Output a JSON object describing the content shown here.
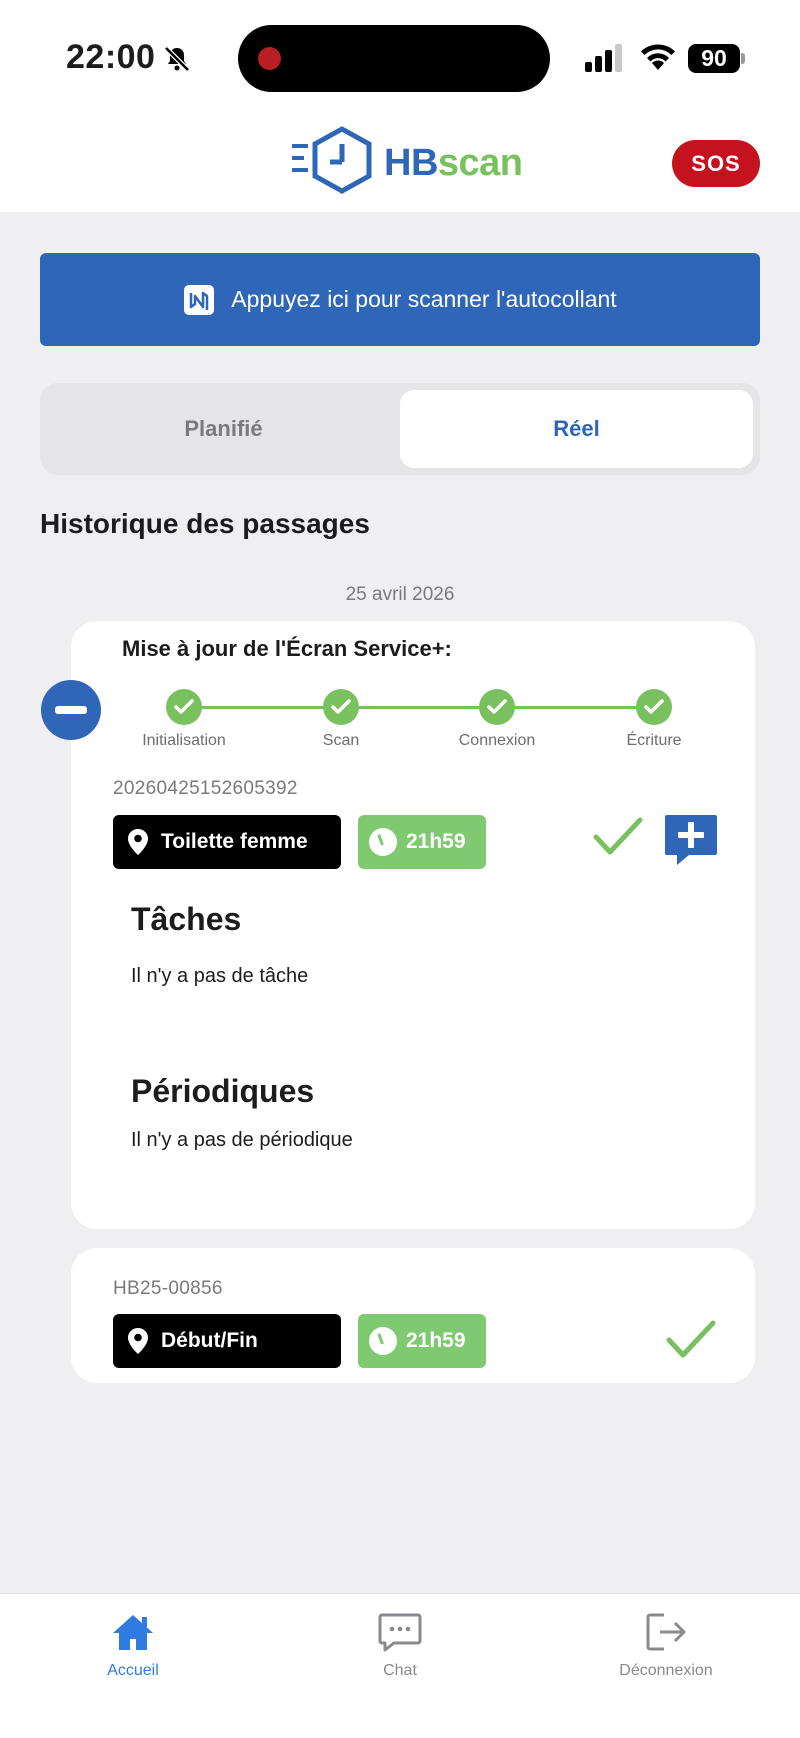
{
  "status_bar": {
    "time": "22:00",
    "battery": "90"
  },
  "header": {
    "logo_hb": "HB",
    "logo_scan": "scan",
    "sos_label": "SOS"
  },
  "scan_banner": {
    "label": "Appuyez ici pour scanner l'autocollant"
  },
  "segment": {
    "planned": "Planifié",
    "real": "Réel",
    "selected": "Réel"
  },
  "history": {
    "title": "Historique des passages",
    "date": "25 avril 2026"
  },
  "update": {
    "title": "Mise à jour de l'Écran Service+:",
    "steps": [
      "Initialisation",
      "Scan",
      "Connexion",
      "Écriture"
    ]
  },
  "passages": [
    {
      "ref": "20260425152605392",
      "location": "Toilette femme",
      "time": "21h59",
      "tasks_title": "Tâches",
      "tasks_empty": "Il n'y a pas de tâche",
      "periodic_title": "Périodiques",
      "periodic_empty": "Il n'y a pas de périodique"
    },
    {
      "ref": "HB25-00856",
      "location": "Début/Fin",
      "time": "21h59"
    }
  ],
  "colors": {
    "primary": "#2f66b8",
    "success": "#79c15f",
    "sos": "#c4121e",
    "active_tab": "#2f7be0"
  },
  "tabbar": {
    "home": "Accueil",
    "chat": "Chat",
    "logout": "Déconnexion",
    "active": "Accueil"
  }
}
